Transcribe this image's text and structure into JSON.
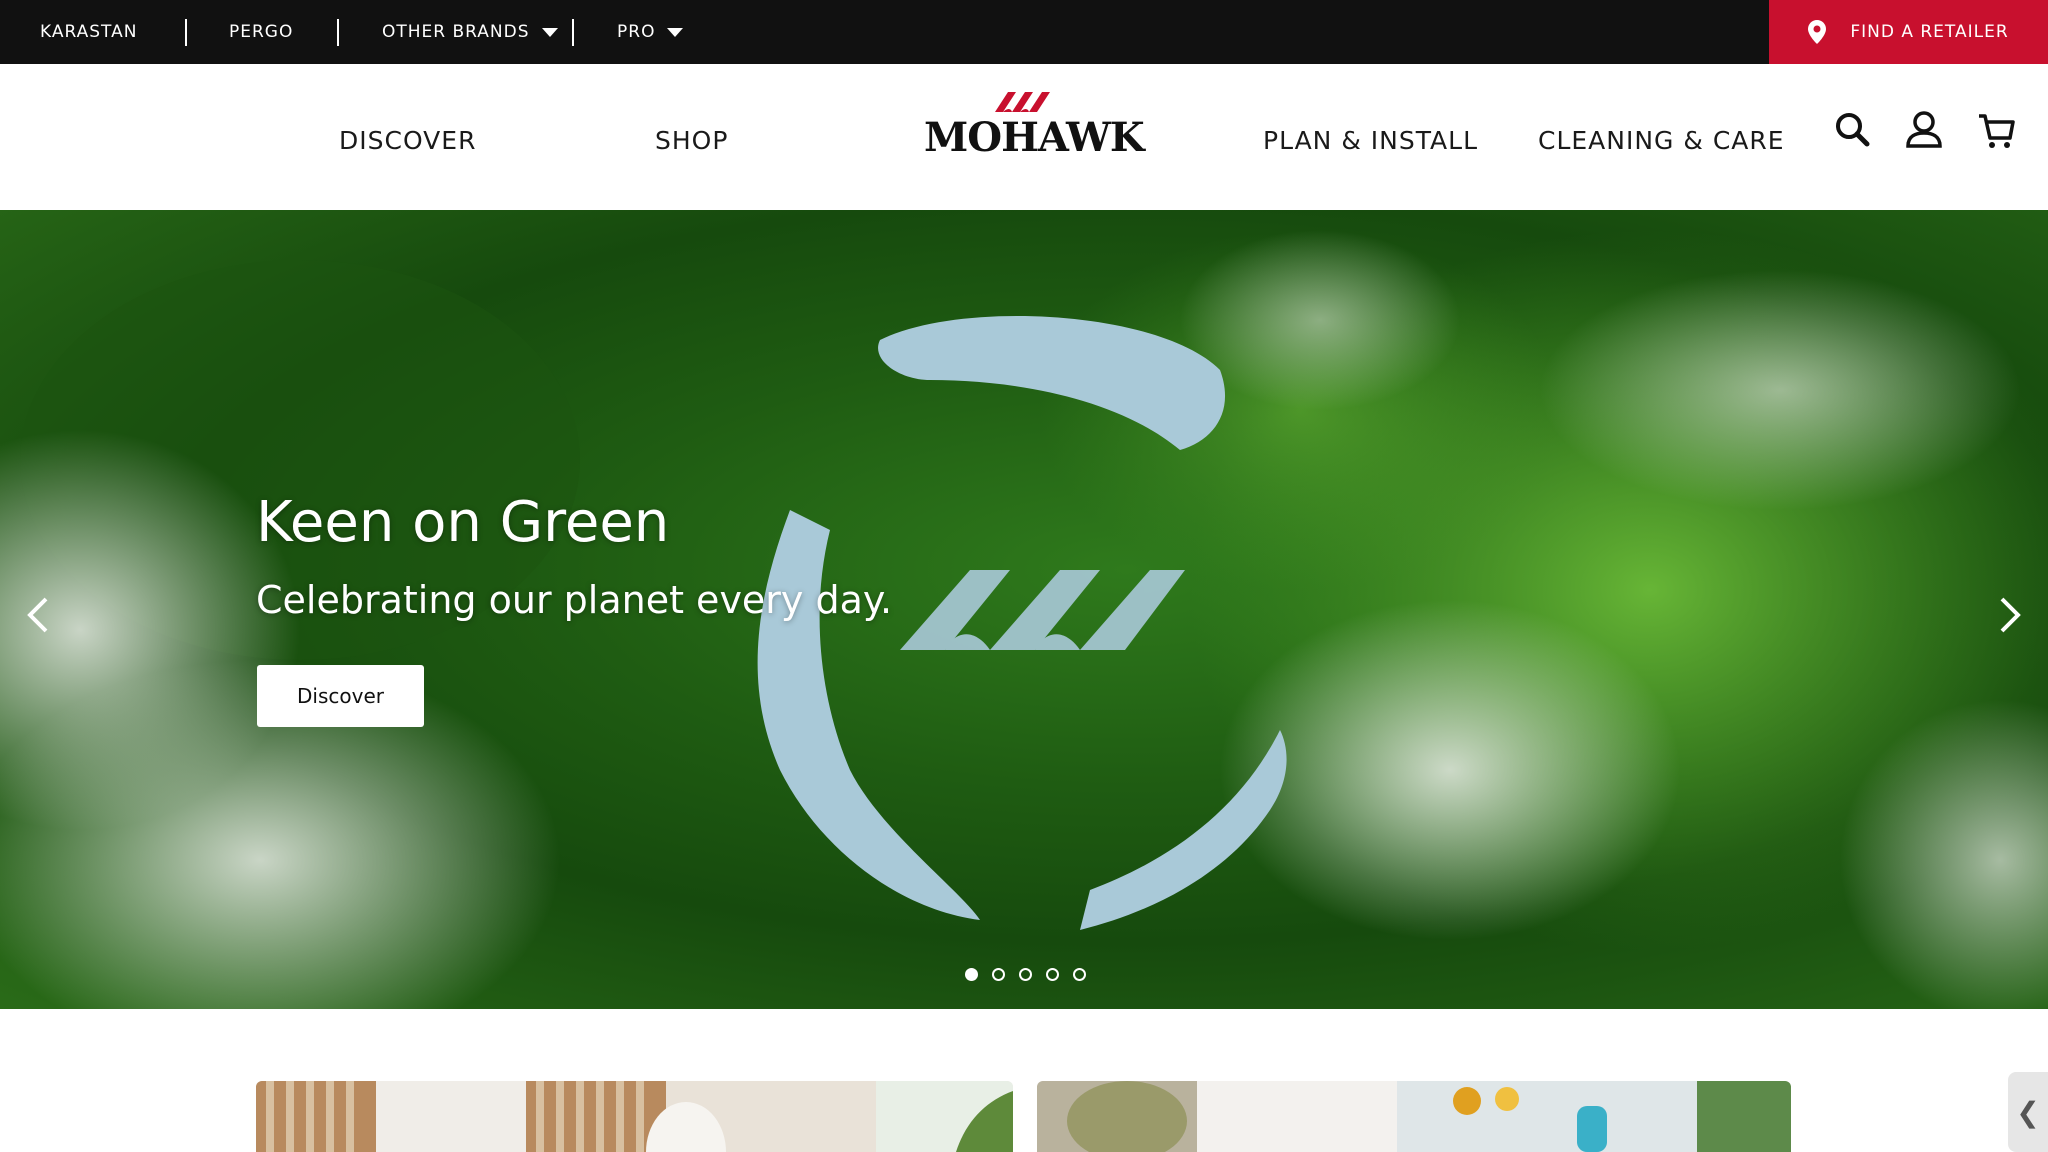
{
  "topbar": {
    "brands": [
      "KARASTAN",
      "PERGO",
      "OTHER BRANDS",
      "PRO"
    ],
    "find_retailer": "FIND A RETAILER"
  },
  "nav": {
    "logo_text": "MOHAWK",
    "left": [
      "DISCOVER",
      "SHOP"
    ],
    "right": [
      "PLAN & INSTALL",
      "CLEANING & CARE"
    ],
    "icons": [
      "search-icon",
      "account-icon",
      "cart-icon"
    ]
  },
  "hero": {
    "title": "Keen on Green",
    "subtitle": "Celebrating our planet every day.",
    "button": "Discover",
    "slides": 5,
    "active_slide": 1
  },
  "side_tab": {
    "glyph": "❮"
  },
  "colors": {
    "topbar": "#111111",
    "accent": "#c8102e",
    "forest": "#1f5c12",
    "water": "#a9c9d8"
  }
}
